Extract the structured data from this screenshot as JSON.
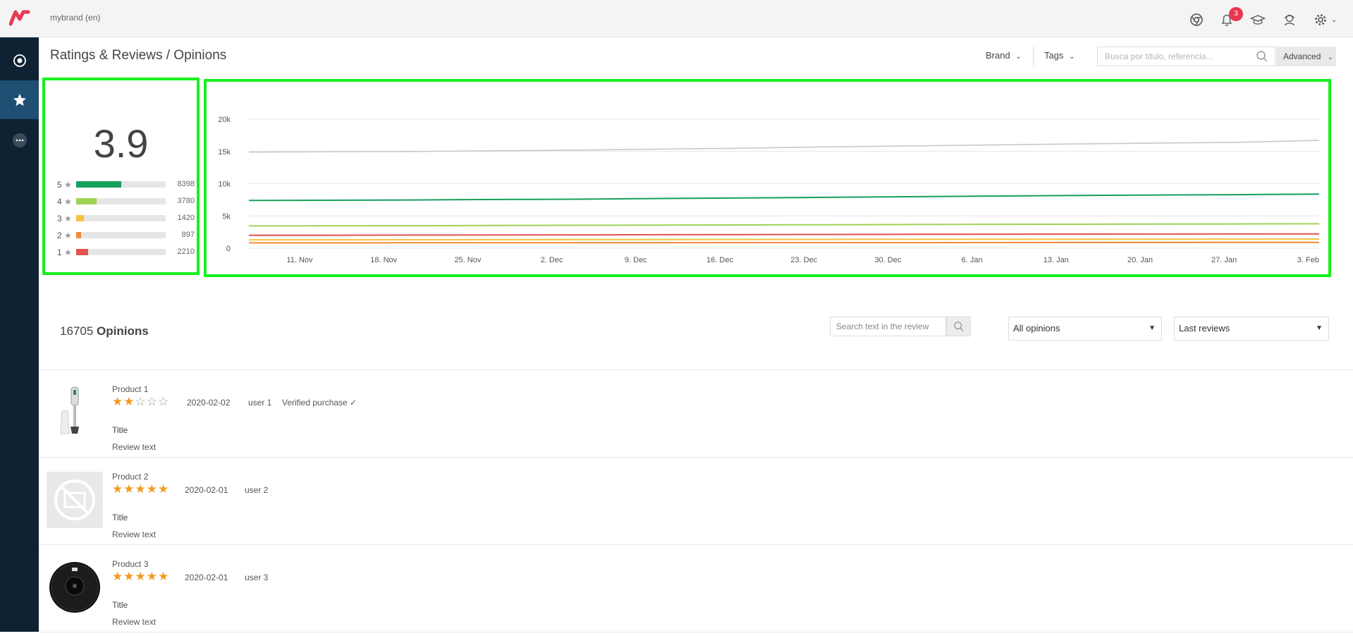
{
  "topbar": {
    "brand": "mybrand (en)",
    "notification_count": "3",
    "icons": [
      "logo-icon",
      "chrome-icon",
      "bell-icon",
      "graduation-cap-icon",
      "support-agent-icon",
      "gear-icon"
    ]
  },
  "sidebar": {
    "items": [
      {
        "name": "dashboard",
        "icon": "target-icon"
      },
      {
        "name": "ratings",
        "icon": "star-icon",
        "active": true
      },
      {
        "name": "more",
        "icon": "more-icon"
      }
    ]
  },
  "header": {
    "title": "Ratings & Reviews / Opinions",
    "brand_filter": "Brand",
    "tags_filter": "Tags",
    "search_placeholder": "Busca por título, referencia...",
    "advanced_label": "Advanced"
  },
  "rating_summary": {
    "average": "3.9",
    "distribution": [
      {
        "stars": "5",
        "count": "8398",
        "fraction": 0.5,
        "color": "#16a05d"
      },
      {
        "stars": "4",
        "count": "3780",
        "fraction": 0.23,
        "color": "#9fd356"
      },
      {
        "stars": "3",
        "count": "1420",
        "fraction": 0.085,
        "color": "#f5c242"
      },
      {
        "stars": "2",
        "count": "897",
        "fraction": 0.054,
        "color": "#f08a3c"
      },
      {
        "stars": "1",
        "count": "2210",
        "fraction": 0.13,
        "color": "#e3524f"
      }
    ]
  },
  "chart_data": {
    "type": "line",
    "title": "",
    "xlabel": "",
    "ylabel": "",
    "x_ticks": [
      "11. Nov",
      "18. Nov",
      "25. Nov",
      "2. Dec",
      "9. Dec",
      "16. Dec",
      "23. Dec",
      "30. Dec",
      "6. Jan",
      "13. Jan",
      "20. Jan",
      "27. Jan",
      "3. Feb"
    ],
    "y_ticks": [
      "0",
      "5k",
      "10k",
      "15k",
      "20k"
    ],
    "ylim": [
      0,
      20000
    ],
    "grid": true,
    "legend": "none",
    "series": [
      {
        "color": "#c8c8c8",
        "values": [
          14900,
          14950,
          15000,
          15100,
          15200,
          15350,
          15500,
          15700,
          15850,
          16000,
          16150,
          16300,
          16400,
          16705
        ]
      },
      {
        "color": "#16a05d",
        "values": [
          7400,
          7430,
          7480,
          7550,
          7600,
          7700,
          7780,
          7880,
          7980,
          8080,
          8160,
          8240,
          8300,
          8398
        ]
      },
      {
        "color": "#9fd356",
        "values": [
          3450,
          3460,
          3490,
          3520,
          3550,
          3580,
          3610,
          3640,
          3670,
          3700,
          3720,
          3740,
          3760,
          3780
        ]
      },
      {
        "color": "#e3524f",
        "values": [
          2000,
          2010,
          2030,
          2050,
          2070,
          2090,
          2110,
          2130,
          2150,
          2170,
          2185,
          2195,
          2205,
          2210
        ]
      },
      {
        "color": "#f5c242",
        "values": [
          1300,
          1305,
          1315,
          1325,
          1335,
          1345,
          1355,
          1365,
          1375,
          1385,
          1395,
          1405,
          1412,
          1420
        ]
      },
      {
        "color": "#f08a3c",
        "values": [
          830,
          833,
          838,
          843,
          848,
          853,
          858,
          863,
          868,
          873,
          880,
          886,
          892,
          897
        ]
      }
    ]
  },
  "opinions": {
    "count": "16705",
    "count_label": "Opinions",
    "search_placeholder": "Search text in the review",
    "filter_select": "All opinions",
    "sort_select": "Last reviews"
  },
  "reviews": [
    {
      "product": "Product 1",
      "rating": 2,
      "date": "2020-02-02",
      "user": "user 1",
      "verified": "Verified purchase ✓",
      "title": "Title",
      "text": "Review text",
      "thumb": "hand-blender"
    },
    {
      "product": "Product 2",
      "rating": 5,
      "date": "2020-02-01",
      "user": "user 2",
      "verified": "",
      "title": "Title",
      "text": "Review text",
      "thumb": "no-image"
    },
    {
      "product": "Product 3",
      "rating": 5,
      "date": "2020-02-01",
      "user": "user 3",
      "verified": "",
      "title": "Title",
      "text": "Review text",
      "thumb": "robot-vacuum"
    }
  ]
}
